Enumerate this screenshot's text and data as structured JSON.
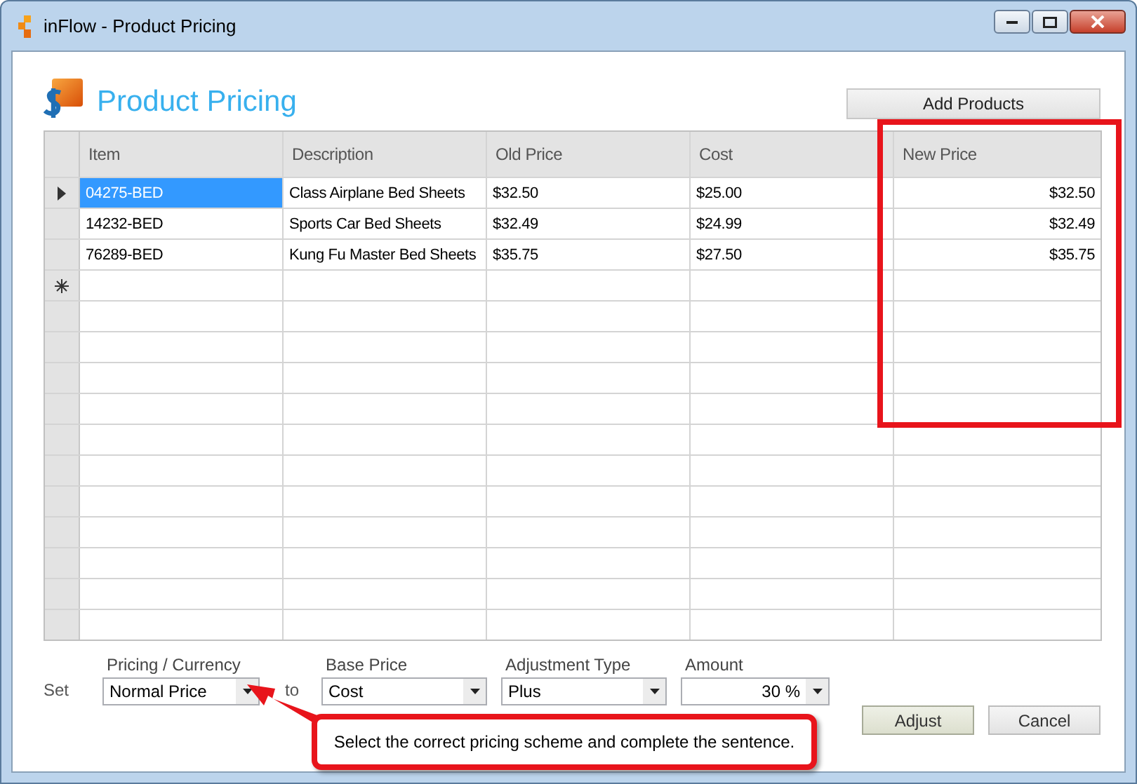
{
  "window": {
    "title": "inFlow - Product Pricing"
  },
  "heading": "Product Pricing",
  "add_button": "Add Products",
  "table": {
    "columns": [
      "Item",
      "Description",
      "Old Price",
      "Cost",
      "New Price"
    ],
    "rows": [
      {
        "selected": true,
        "cells": [
          "04275-BED",
          "Class Airplane Bed Sheets",
          "$32.50",
          "$25.00",
          "$32.50"
        ]
      },
      {
        "selected": false,
        "cells": [
          "14232-BED",
          "Sports Car Bed Sheets",
          "$32.49",
          "$24.99",
          "$32.49"
        ]
      },
      {
        "selected": false,
        "cells": [
          "76289-BED",
          "Kung Fu Master Bed Sheets",
          "$35.75",
          "$27.50",
          "$35.75"
        ]
      }
    ]
  },
  "form": {
    "set_label": "Set",
    "to_label": "to",
    "fields": [
      {
        "label": "Pricing / Currency",
        "value": "Normal Price"
      },
      {
        "label": "Base Price",
        "value": "Cost"
      },
      {
        "label": "Adjustment Type",
        "value": "Plus"
      },
      {
        "label": "Amount",
        "value": "30 %"
      }
    ]
  },
  "buttons": [
    {
      "label": "Adjust",
      "default": true
    },
    {
      "label": "Cancel",
      "default": false
    }
  ],
  "callout": "Select the correct pricing scheme and complete the sentence."
}
